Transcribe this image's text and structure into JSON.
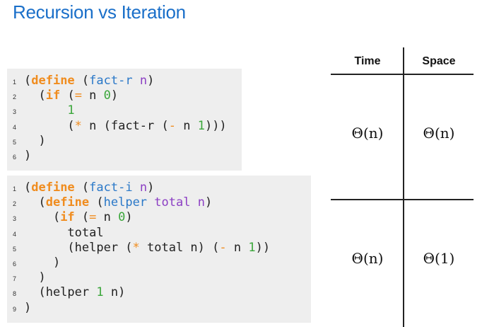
{
  "title": "Recursion vs Iteration",
  "code1": {
    "lines": [
      {
        "n": "1",
        "tokens": [
          [
            "paren",
            "("
          ],
          [
            "kw",
            "define"
          ],
          [
            "paren",
            " ("
          ],
          [
            "fn",
            "fact-r"
          ],
          [
            "paren",
            " "
          ],
          [
            "var",
            "n"
          ],
          [
            "paren",
            ")"
          ]
        ]
      },
      {
        "n": "2",
        "tokens": [
          [
            "paren",
            "  ("
          ],
          [
            "kw",
            "if"
          ],
          [
            "paren",
            " ("
          ],
          [
            "op",
            "="
          ],
          [
            "paren",
            " n "
          ],
          [
            "num",
            "0"
          ],
          [
            "paren",
            ")"
          ]
        ]
      },
      {
        "n": "3",
        "tokens": [
          [
            "paren",
            "      "
          ],
          [
            "num",
            "1"
          ]
        ]
      },
      {
        "n": "4",
        "tokens": [
          [
            "paren",
            "      ("
          ],
          [
            "op",
            "*"
          ],
          [
            "paren",
            " n (fact-r ("
          ],
          [
            "op",
            "-"
          ],
          [
            "paren",
            " n "
          ],
          [
            "num",
            "1"
          ],
          [
            "paren",
            ")))"
          ]
        ]
      },
      {
        "n": "5",
        "tokens": [
          [
            "paren",
            "  )"
          ]
        ]
      },
      {
        "n": "6",
        "tokens": [
          [
            "paren",
            ")"
          ]
        ]
      }
    ]
  },
  "code2": {
    "lines": [
      {
        "n": "1",
        "tokens": [
          [
            "paren",
            "("
          ],
          [
            "kw",
            "define"
          ],
          [
            "paren",
            " ("
          ],
          [
            "fn",
            "fact-i"
          ],
          [
            "paren",
            " "
          ],
          [
            "var",
            "n"
          ],
          [
            "paren",
            ")"
          ]
        ]
      },
      {
        "n": "2",
        "tokens": [
          [
            "paren",
            "  ("
          ],
          [
            "kw",
            "define"
          ],
          [
            "paren",
            " ("
          ],
          [
            "fn",
            "helper"
          ],
          [
            "paren",
            " "
          ],
          [
            "var",
            "total n"
          ],
          [
            "paren",
            ")"
          ]
        ]
      },
      {
        "n": "3",
        "tokens": [
          [
            "paren",
            "    ("
          ],
          [
            "kw",
            "if"
          ],
          [
            "paren",
            " ("
          ],
          [
            "op",
            "="
          ],
          [
            "paren",
            " n "
          ],
          [
            "num",
            "0"
          ],
          [
            "paren",
            ")"
          ]
        ]
      },
      {
        "n": "4",
        "tokens": [
          [
            "paren",
            "      total"
          ]
        ]
      },
      {
        "n": "5",
        "tokens": [
          [
            "paren",
            "      (helper ("
          ],
          [
            "op",
            "*"
          ],
          [
            "paren",
            " total n) ("
          ],
          [
            "op",
            "-"
          ],
          [
            "paren",
            " n "
          ],
          [
            "num",
            "1"
          ],
          [
            "paren",
            "))"
          ]
        ]
      },
      {
        "n": "6",
        "tokens": [
          [
            "paren",
            "    )"
          ]
        ]
      },
      {
        "n": "7",
        "tokens": [
          [
            "paren",
            "  )"
          ]
        ]
      },
      {
        "n": "8",
        "tokens": [
          [
            "paren",
            "  (helper "
          ],
          [
            "num",
            "1"
          ],
          [
            "paren",
            " n)"
          ]
        ]
      },
      {
        "n": "9",
        "tokens": [
          [
            "paren",
            ")"
          ]
        ]
      }
    ]
  },
  "table": {
    "headers": [
      "Time",
      "Space"
    ],
    "rows": [
      {
        "time": "Θ(n)",
        "space": "Θ(n)"
      },
      {
        "time": "Θ(n)",
        "space": "Θ(1)"
      }
    ]
  }
}
